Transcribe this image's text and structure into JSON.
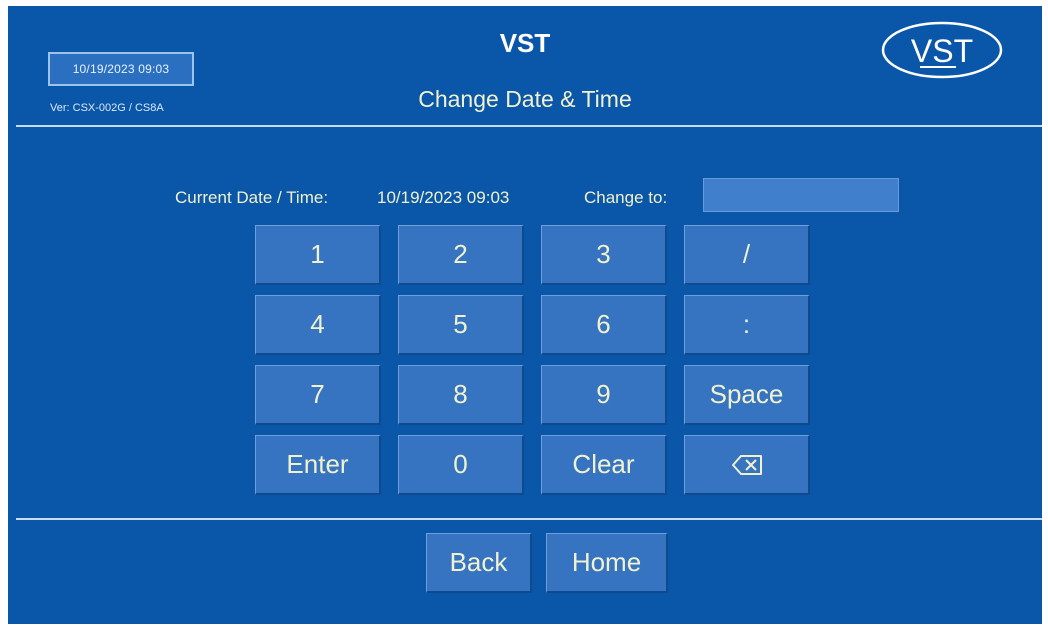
{
  "header": {
    "datetime": "10/19/2023 09:03",
    "version": "Ver: CSX-002G / CS8A",
    "title": "VST",
    "subtitle": "Change Date & Time",
    "logo_text": "VST"
  },
  "form": {
    "current_label": "Current Date / Time:",
    "current_value": "10/19/2023 09:03",
    "change_label": "Change to:",
    "change_value": ""
  },
  "keypad": {
    "keys": [
      "1",
      "2",
      "3",
      "/",
      "4",
      "5",
      "6",
      ":",
      "7",
      "8",
      "9",
      "Space",
      "Enter",
      "0",
      "Clear"
    ],
    "backspace_icon": "backspace-icon"
  },
  "nav": {
    "back_label": "Back",
    "home_label": "Home"
  },
  "colors": {
    "background": "#0a56a9",
    "button": "#3674c2",
    "text": "#f0f2cf"
  }
}
